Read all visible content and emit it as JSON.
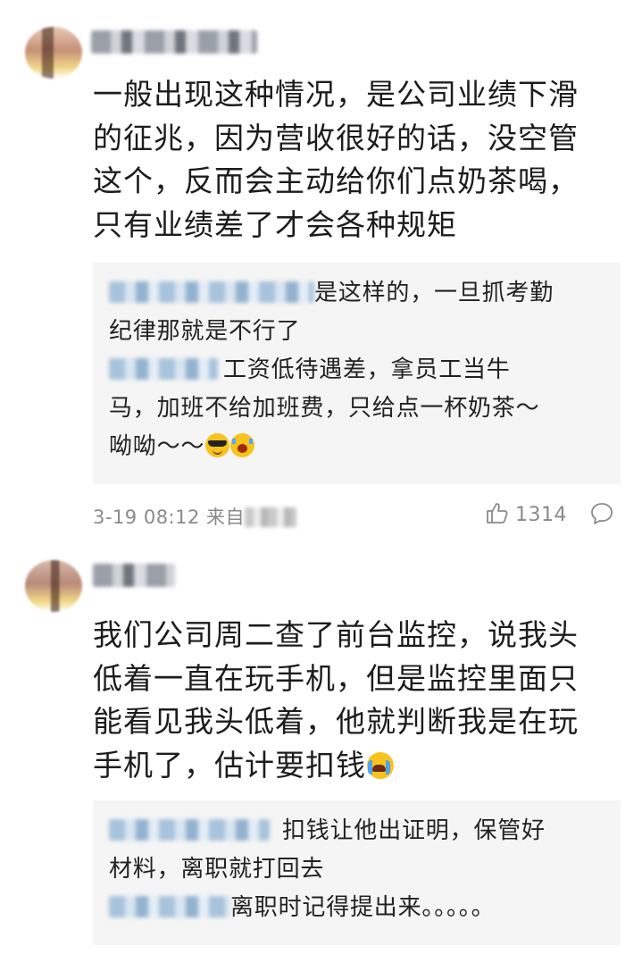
{
  "comments": [
    {
      "content": [
        "一般出现这种情况，是公司业绩下滑",
        "的征兆，因为营收很好的话，没空管",
        "这个，反而会主动给你们点奶茶喝，",
        "只有业绩差了才会各种规矩"
      ],
      "replies": [
        {
          "line1": "是这样的，一旦抓考勤",
          "line2": "纪律那就是不行了"
        },
        {
          "line1": "工资低待遇差，拿员工当牛",
          "line2": "马，加班不给加班费，只给点一杯奶茶～",
          "line3": "呦呦～～"
        }
      ],
      "time": "3-19 08:12",
      "source_prefix": "来自",
      "likes": "1314",
      "emojis": [
        "cool-emoji",
        "crying-laughing-emoji"
      ]
    },
    {
      "content": [
        "我们公司周二查了前台监控，说我头",
        "低着一直在玩手机，但是监控里面只",
        "能看见我头低着，他就判断我是在玩",
        "手机了，估计要扣钱"
      ],
      "replies": [
        {
          "line1": "扣钱让他出证明，保管好",
          "line2": "材料，离职就打回去"
        },
        {
          "line1": "离职时记得提出来。。。。。"
        }
      ],
      "emojis": [
        "sobbing-emoji"
      ]
    }
  ],
  "icons": {
    "like": "thumbs-up-icon",
    "comment": "comment-bubble-icon"
  },
  "colors": {
    "background": "#ffffff",
    "reply_bg": "#f5f5f5",
    "meta_text": "#8a8a8a",
    "blur_name": "#a8c3dc"
  }
}
